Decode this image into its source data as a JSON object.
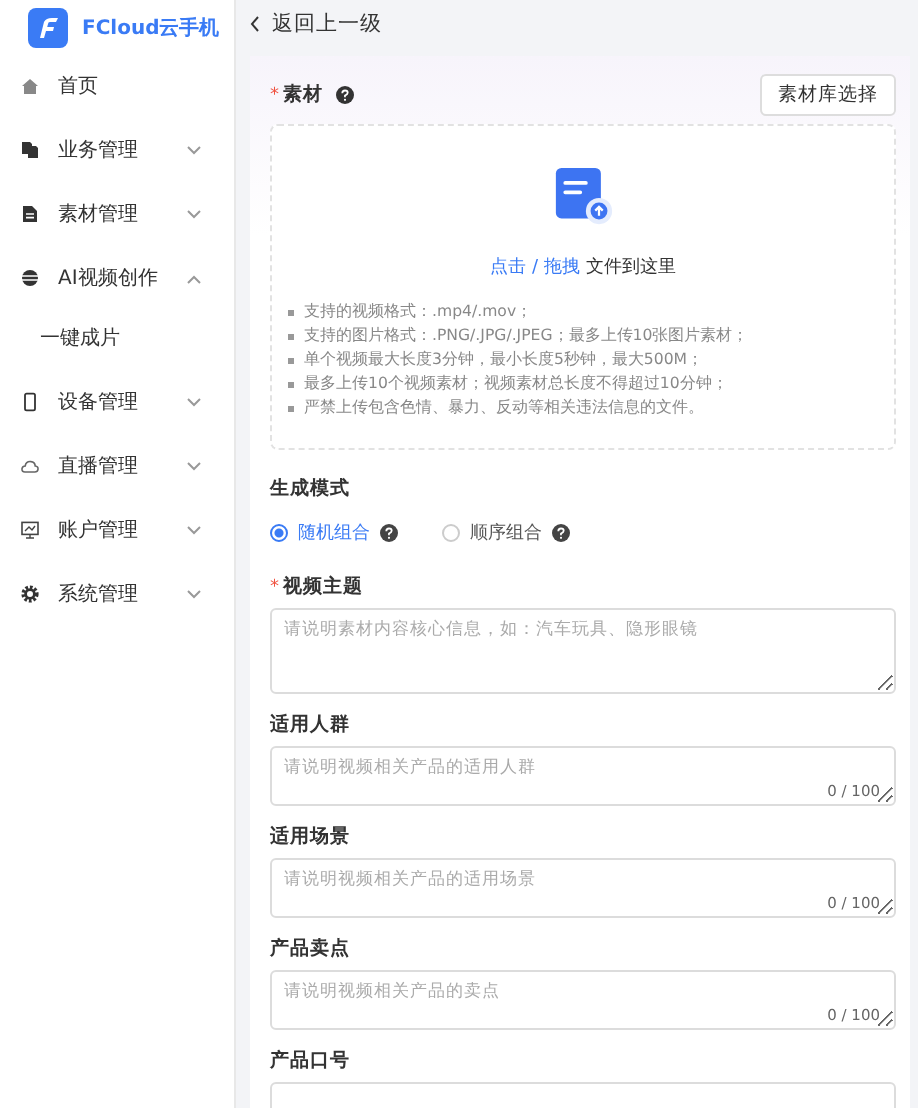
{
  "brand": {
    "name": "FCloud云手机"
  },
  "sidebar": {
    "items": [
      {
        "label": "首页",
        "kind": "link"
      },
      {
        "label": "业务管理",
        "kind": "group",
        "expanded": false
      },
      {
        "label": "素材管理",
        "kind": "group",
        "expanded": false
      },
      {
        "label": "AI视频创作",
        "kind": "group",
        "expanded": true,
        "children": [
          {
            "label": "一键成片"
          }
        ]
      },
      {
        "label": "设备管理",
        "kind": "group",
        "expanded": false
      },
      {
        "label": "直播管理",
        "kind": "group",
        "expanded": false
      },
      {
        "label": "账户管理",
        "kind": "group",
        "expanded": false
      },
      {
        "label": "系统管理",
        "kind": "group",
        "expanded": false
      }
    ]
  },
  "back": {
    "label": "返回上一级"
  },
  "material": {
    "label": "素材",
    "required_mark": "*",
    "library_button": "素材库选择",
    "upload_link": "点击 / 拖拽",
    "upload_text": "文件到这里",
    "notes": [
      "支持的视频格式：.mp4/.mov；",
      "支持的图片格式：.PNG/.JPG/.JPEG；最多上传10张图片素材；",
      "单个视频最大长度3分钟，最小长度5秒钟，最大500M；",
      "最多上传10个视频素材；视频素材总长度不得超过10分钟；",
      "严禁上传包含色情、暴力、反动等相关违法信息的文件。"
    ]
  },
  "mode": {
    "label": "生成模式",
    "options": [
      {
        "label": "随机组合",
        "selected": true
      },
      {
        "label": "顺序组合",
        "selected": false
      }
    ]
  },
  "fields": [
    {
      "label": "视频主题",
      "required_mark": "*",
      "placeholder": "请说明素材内容核心信息，如：汽车玩具、隐形眼镜",
      "tall": true
    },
    {
      "label": "适用人群",
      "placeholder": "请说明视频相关产品的适用人群",
      "counter": "0 / 100"
    },
    {
      "label": "适用场景",
      "placeholder": "请说明视频相关产品的适用场景",
      "counter": "0 / 100"
    },
    {
      "label": "产品卖点",
      "placeholder": "请说明视频相关产品的卖点",
      "counter": "0 / 100"
    },
    {
      "label": "产品口号"
    }
  ]
}
